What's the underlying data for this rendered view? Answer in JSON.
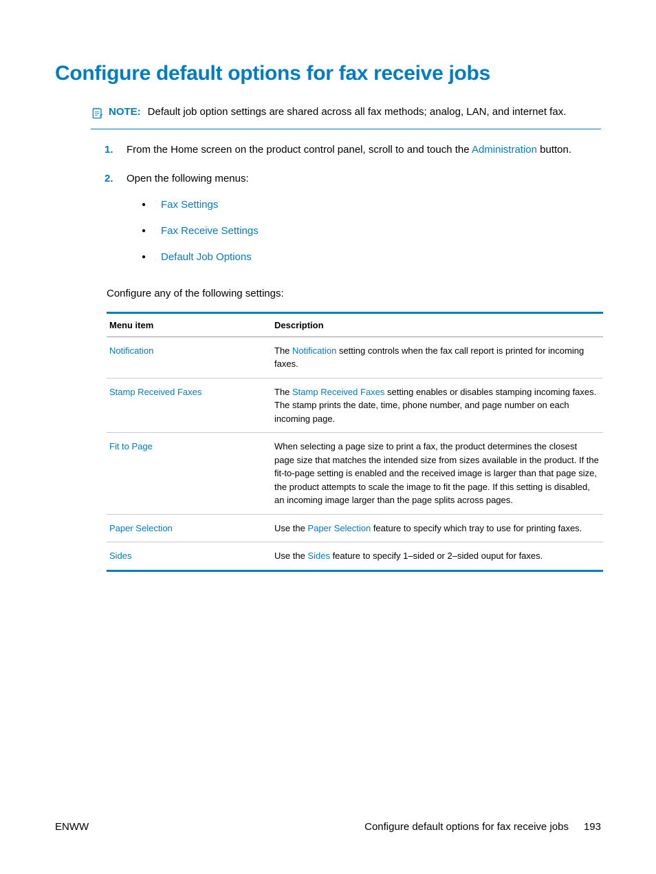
{
  "title": "Configure default options for fax receive jobs",
  "note": {
    "label": "NOTE:",
    "text": "Default job option settings are shared across all fax methods; analog, LAN, and internet fax."
  },
  "steps": {
    "num1": "1.",
    "num2": "2.",
    "step1_pre": "From the Home screen on the product control panel, scroll to and touch the ",
    "step1_link": "Administration",
    "step1_post": " button.",
    "step2": "Open the following menus:",
    "bullets": {
      "b1": "Fax Settings",
      "b2": "Fax Receive Settings",
      "b3": "Default Job Options"
    }
  },
  "intro": "Configure any of the following settings:",
  "table": {
    "h1": "Menu item",
    "h2": "Description",
    "rows": {
      "r1": {
        "menu": "Notification",
        "d_pre": "The ",
        "d_link": "Notification",
        "d_post": " setting controls when the fax call report is printed for incoming faxes."
      },
      "r2": {
        "menu": "Stamp Received Faxes",
        "d_pre": "The ",
        "d_link": "Stamp Received Faxes",
        "d_post": " setting enables or disables stamping incoming faxes. The stamp prints the date, time, phone number, and page number on each incoming page."
      },
      "r3": {
        "menu": "Fit to Page",
        "d": "When selecting a page size to print a fax, the product determines the closest page size that matches the intended size from sizes available in the product. If the fit-to-page setting is enabled and the received image is larger than that page size, the product attempts to scale the image to fit the page. If this setting is disabled, an incoming image larger than the page splits across pages."
      },
      "r4": {
        "menu": "Paper Selection",
        "d_pre": "Use the ",
        "d_link": "Paper Selection",
        "d_post": " feature to specify which tray to use for printing faxes."
      },
      "r5": {
        "menu": "Sides",
        "d_pre": "Use the ",
        "d_link": "Sides",
        "d_post": " feature to specify 1–sided or 2–sided ouput for faxes."
      }
    }
  },
  "footer": {
    "left": "ENWW",
    "right_text": "Configure default options for fax receive jobs",
    "page": "193"
  }
}
